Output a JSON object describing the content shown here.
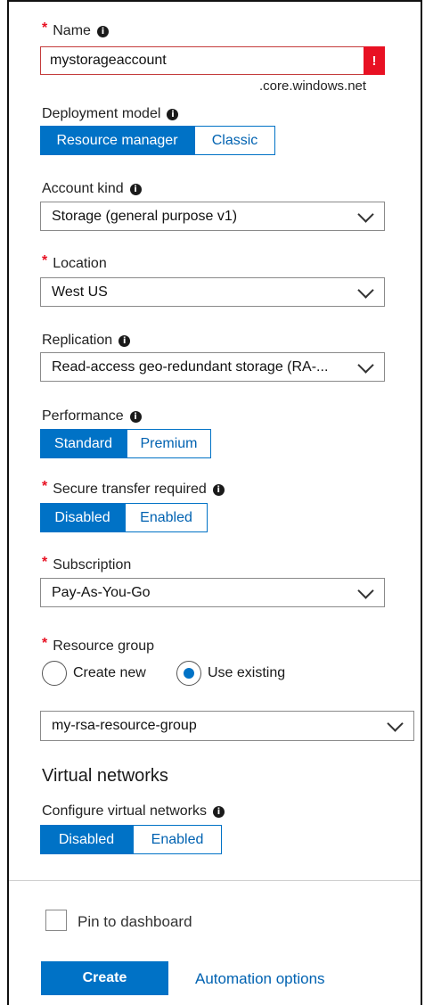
{
  "name": {
    "label": "Name",
    "value": "mystorageaccount",
    "error": "!",
    "suffix": ".core.windows.net"
  },
  "deployment_model": {
    "label": "Deployment model",
    "options": [
      "Resource manager",
      "Classic"
    ],
    "selected": "Resource manager"
  },
  "account_kind": {
    "label": "Account kind",
    "value": "Storage (general purpose v1)"
  },
  "location": {
    "label": "Location",
    "value": "West US"
  },
  "replication": {
    "label": "Replication",
    "value": "Read-access geo-redundant storage (RA-..."
  },
  "performance": {
    "label": "Performance",
    "options": [
      "Standard",
      "Premium"
    ],
    "selected": "Standard"
  },
  "secure_transfer": {
    "label": "Secure transfer required",
    "options": [
      "Disabled",
      "Enabled"
    ],
    "selected": "Disabled"
  },
  "subscription": {
    "label": "Subscription",
    "value": "Pay-As-You-Go"
  },
  "resource_group": {
    "label": "Resource group",
    "radio_create": "Create new",
    "radio_existing": "Use existing",
    "selected": "Use existing",
    "value": "my-rsa-resource-group"
  },
  "virtual_networks": {
    "heading": "Virtual networks",
    "label": "Configure virtual networks",
    "options": [
      "Disabled",
      "Enabled"
    ],
    "selected": "Disabled"
  },
  "footer": {
    "pin_label": "Pin to dashboard",
    "create_label": "Create",
    "automation_label": "Automation options"
  },
  "glyphs": {
    "required": "*",
    "info": "i"
  },
  "colors": {
    "accent": "#0072c6",
    "error": "#e81123",
    "required": "#e81123"
  }
}
